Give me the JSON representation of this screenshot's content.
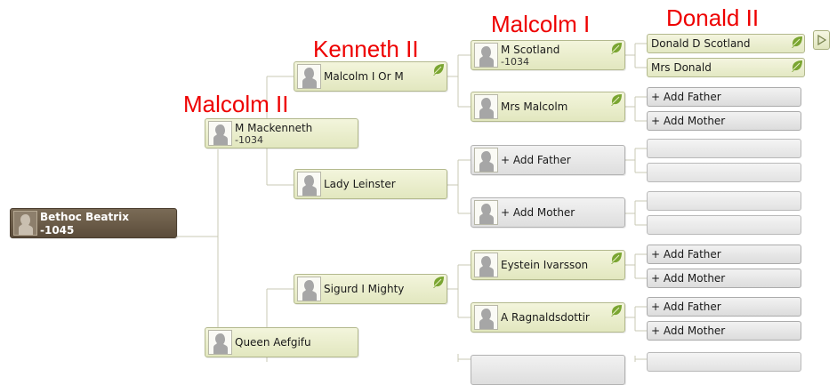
{
  "annotations": {
    "gen1": "Malcolm II",
    "gen2": "Kenneth II",
    "gen3": "Malcolm I",
    "gen4": "Donald II"
  },
  "root": {
    "name": "Bethoc Beatrix",
    "date": "-1045"
  },
  "father": {
    "name": "M Mackenneth",
    "date": "-1034"
  },
  "mother": {
    "name": "Queen Aefgifu"
  },
  "paternal_grandfather": {
    "name": "Malcolm I Or M"
  },
  "paternal_grandmother": {
    "name": "Lady Leinster"
  },
  "maternal_grandfather": {
    "name": "Sigurd I Mighty"
  },
  "ggen": {
    "g1": {
      "name": "M Scotland",
      "date": "-1034"
    },
    "g2": {
      "name": "Mrs Malcolm"
    },
    "g3": {
      "label": "+ Add Father"
    },
    "g4": {
      "label": "+ Add Mother"
    },
    "g5": {
      "name": "Eystein Ivarsson"
    },
    "g6": {
      "name": "A Ragnaldsdottir"
    }
  },
  "gggen": {
    "s1": "Donald D Scotland",
    "s2": "Mrs Donald",
    "s3": "+ Add Father",
    "s4": "+ Add Mother",
    "s9": "+ Add Father",
    "s10": "+ Add Mother",
    "s11": "+ Add Father",
    "s12": "+ Add Mother"
  },
  "icons": {
    "silhouette": "person-silhouette-icon",
    "leaf": "leaf-hint-icon",
    "next": "play-arrow-icon"
  },
  "colors": {
    "annotation": "#ee0000",
    "card_fill": "#e8ecc9",
    "root_fill": "#6a5b48",
    "empty_fill": "#e6e6e6",
    "leaf_green": "#7aa531"
  }
}
